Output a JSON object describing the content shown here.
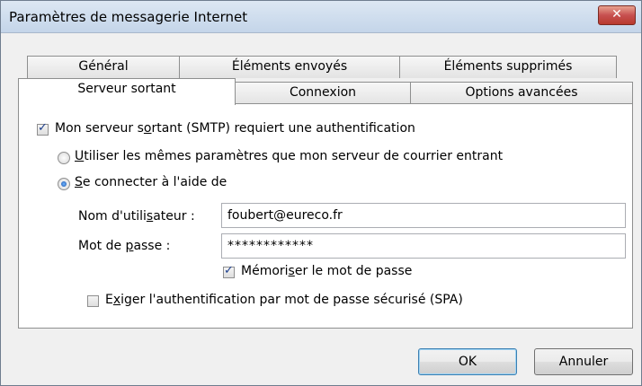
{
  "window": {
    "title": "Paramètres de messagerie Internet",
    "close_glyph": "✕"
  },
  "tabs": {
    "row1": [
      "Général",
      "Éléments envoyés",
      "Éléments supprimés"
    ],
    "row2": [
      "Serveur sortant",
      "Connexion",
      "Options avancées"
    ],
    "active": "Serveur sortant"
  },
  "panel": {
    "smtp_auth": {
      "label": "Mon serveur sortant (SMTP) requiert une authentification",
      "checked": true
    },
    "radio_same": {
      "label": "Utiliser les mêmes paramètres que mon serveur de courrier entrant",
      "checked": false
    },
    "radio_login": {
      "label": "Se connecter à l'aide de",
      "checked": true
    },
    "username": {
      "label": "Nom d'utilisateur :",
      "value": "foubert@eureco.fr"
    },
    "password": {
      "label": "Mot de passe :",
      "value": "************"
    },
    "remember": {
      "label": "Mémoriser le mot de passe",
      "checked": true
    },
    "spa": {
      "label": "Exiger l'authentification par mot de passe sécurisé (SPA)",
      "checked": false
    }
  },
  "buttons": {
    "ok": "OK",
    "cancel": "Annuler"
  }
}
